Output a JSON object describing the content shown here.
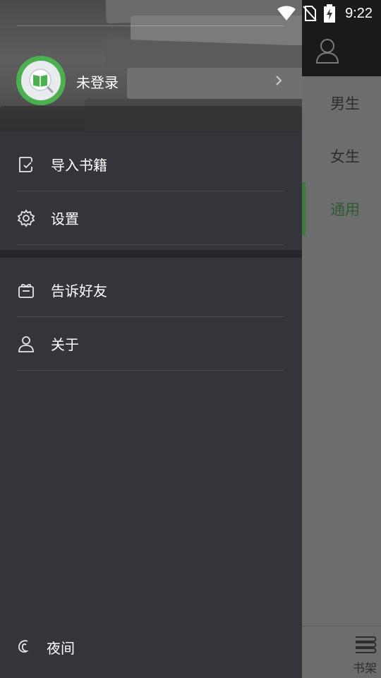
{
  "status_bar": {
    "time": "9:22",
    "icons": [
      "wifi-icon",
      "no-sim-icon",
      "battery-charging-icon"
    ]
  },
  "drawer": {
    "profile": {
      "avatar_icon": "book-search-icon",
      "login_text": "未登录",
      "chevron_icon": "chevron-right-icon"
    },
    "menu_group_1": [
      {
        "label": "导入书籍",
        "icon": "import-book-icon"
      },
      {
        "label": "设置",
        "icon": "gear-icon"
      }
    ],
    "menu_group_2": [
      {
        "label": "告诉好友",
        "icon": "gift-share-icon"
      },
      {
        "label": "关于",
        "icon": "person-icon"
      }
    ],
    "night_mode": {
      "label": "夜间",
      "icon": "moon-icon"
    }
  },
  "background_app": {
    "tabs": [
      {
        "label": "男生",
        "active": false
      },
      {
        "label": "女生",
        "active": false
      },
      {
        "label": "通用",
        "active": true
      }
    ],
    "bottom_nav": {
      "label": "书架",
      "icon": "bookshelf-icon"
    }
  },
  "colors": {
    "accent_green": "#4caf50",
    "drawer_bg": "#33353b",
    "active_tab": "#2f5b2e"
  }
}
